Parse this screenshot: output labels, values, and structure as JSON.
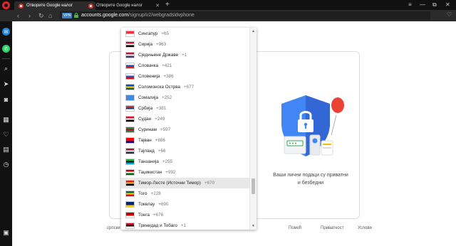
{
  "browser": {
    "tabs": [
      {
        "label": "Отворите Google налог"
      },
      {
        "label": "Отворите Google налог"
      }
    ],
    "new_tab": "+",
    "nav": {
      "back": "‹",
      "forward": "›",
      "reload": "↻",
      "home": "⌂"
    },
    "vpn_badge": "VPN",
    "url_domain": "accounts.google.com",
    "url_path": "/signup/v2/webgradsidvphone",
    "window_controls": [
      "—",
      "⧉",
      "✕"
    ],
    "tab_menu": "≡"
  },
  "sidebar": {
    "items": [
      "messenger-icon",
      "whatsapp-icon",
      "search-icon",
      "send-icon",
      "camera-icon",
      "news-icon",
      "heart-icon",
      "history-icon",
      "clock-icon",
      "panel-icon"
    ]
  },
  "dropdown": {
    "highlighted_index": 14,
    "countries": [
      {
        "name": "Сингапур",
        "code": "+65",
        "flag": [
          "#ef3340",
          "#ffffff"
        ]
      },
      {
        "name": "Сирија",
        "code": "+963",
        "flag": [
          "#ce1126",
          "#ffffff",
          "#000000"
        ]
      },
      {
        "name": "Сједињене Државе",
        "code": "+1",
        "flag": [
          "#b22234",
          "#ffffff",
          "#3c3b6e"
        ]
      },
      {
        "name": "Словачка",
        "code": "+421",
        "flag": [
          "#ffffff",
          "#0b4ea2",
          "#ee1c25"
        ]
      },
      {
        "name": "Словенија",
        "code": "+386",
        "flag": [
          "#ffffff",
          "#005ce6",
          "#ff0000"
        ]
      },
      {
        "name": "Соломонска Острва",
        "code": "+677",
        "flag": [
          "#0051ba",
          "#fcd116",
          "#215b33"
        ]
      },
      {
        "name": "Сомалија",
        "code": "+252",
        "flag": [
          "#4189dd",
          "#4189dd",
          "#4189dd"
        ]
      },
      {
        "name": "Србија",
        "code": "+381",
        "flag": [
          "#c6363c",
          "#0c4076",
          "#ffffff"
        ]
      },
      {
        "name": "Судан",
        "code": "+249",
        "flag": [
          "#d21034",
          "#ffffff",
          "#000000"
        ]
      },
      {
        "name": "Суринам",
        "code": "+597",
        "flag": [
          "#377e3f",
          "#b40a2d",
          "#377e3f"
        ]
      },
      {
        "name": "Тајван",
        "code": "+886",
        "flag": [
          "#fe0000",
          "#fe0000",
          "#000095"
        ]
      },
      {
        "name": "Тајланд",
        "code": "+66",
        "flag": [
          "#a51931",
          "#f4f5f8",
          "#2d2a4a"
        ]
      },
      {
        "name": "Танзанија",
        "code": "+255",
        "flag": [
          "#1eb53a",
          "#000000",
          "#00a3dd"
        ]
      },
      {
        "name": "Таџикистан",
        "code": "+992",
        "flag": [
          "#cc0000",
          "#ffffff",
          "#006600"
        ]
      },
      {
        "name": "Тимор-Лесте (Источни Тимор)",
        "code": "+670",
        "flag": [
          "#dc241f",
          "#ffc726",
          "#000000"
        ]
      },
      {
        "name": "Того",
        "code": "+228",
        "flag": [
          "#006a4e",
          "#ffce00",
          "#d21034"
        ]
      },
      {
        "name": "Токелау",
        "code": "+690",
        "flag": [
          "#00247d",
          "#00247d",
          "#fed100"
        ]
      },
      {
        "name": "Тонга",
        "code": "+676",
        "flag": [
          "#c10000",
          "#c10000",
          "#ffffff"
        ]
      },
      {
        "name": "Тринидад и Тобаго",
        "code": "+1",
        "flag": [
          "#ce1126",
          "#000000",
          "#ffffff"
        ]
      }
    ]
  },
  "page": {
    "tagline_line1": "Ваши лични подаци су приватни",
    "tagline_line2": "и безбедни",
    "footer_lang": "српски",
    "footer_links": [
      "Помоћ",
      "Приватност",
      "Услови"
    ]
  },
  "colors": {
    "accent": "#4285f4",
    "shield": "#4285f4",
    "balloon": "#ea4335"
  }
}
